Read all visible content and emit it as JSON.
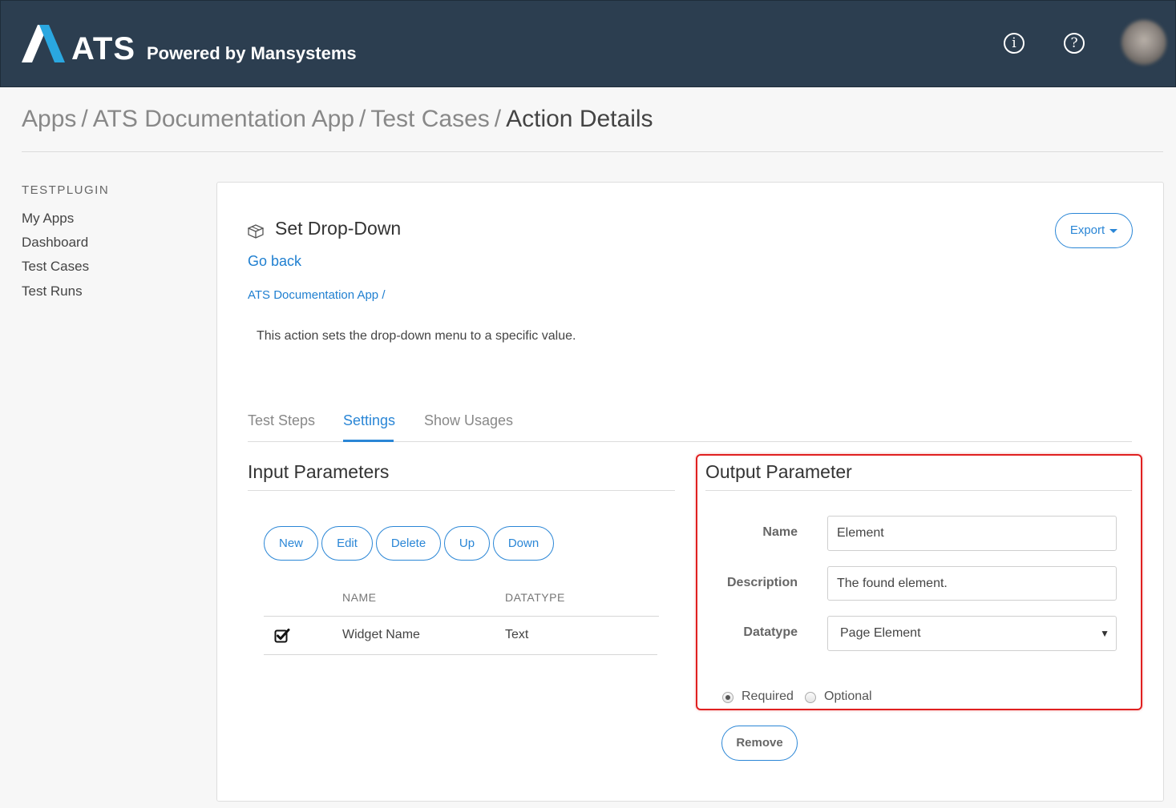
{
  "header": {
    "logo_text": "ATS",
    "powered_by": "Powered by Mansystems",
    "info_icon": "info-icon",
    "help_icon": "help-icon",
    "colors": {
      "bar": "#2c3e50",
      "logo_accent": "#2aa7e0"
    }
  },
  "breadcrumb": {
    "items": [
      "Apps",
      "ATS Documentation App",
      "Test Cases"
    ],
    "separator": "/",
    "current": "Action Details"
  },
  "sidebar": {
    "title": "TESTPLUGIN",
    "items": [
      {
        "label": "My Apps"
      },
      {
        "label": "Dashboard"
      },
      {
        "label": "Test Cases"
      },
      {
        "label": "Test Runs"
      }
    ]
  },
  "action": {
    "title": "Set Drop-Down",
    "go_back": "Go back",
    "app_link": "ATS Documentation App /",
    "description": "This action sets the drop-down menu to a specific value.",
    "export_label": "Export"
  },
  "tabs": [
    {
      "label": "Test Steps",
      "active": false
    },
    {
      "label": "Settings",
      "active": true
    },
    {
      "label": "Show Usages",
      "active": false
    }
  ],
  "input_parameters": {
    "title": "Input Parameters",
    "buttons": [
      "New",
      "Edit",
      "Delete",
      "Up",
      "Down"
    ],
    "columns": [
      "NAME",
      "DATATYPE"
    ],
    "rows": [
      {
        "checked": true,
        "name": "Widget Name",
        "datatype": "Text"
      }
    ]
  },
  "output_parameter": {
    "title": "Output Parameter",
    "name_label": "Name",
    "name_value": "Element",
    "description_label": "Description",
    "description_value": "The found element.",
    "datatype_label": "Datatype",
    "datatype_value": "Page Element",
    "required_label": "Required",
    "optional_label": "Optional",
    "selected": "Required",
    "remove_label": "Remove",
    "highlight_color": "#e02020"
  },
  "accent_color": "#2a86d6"
}
